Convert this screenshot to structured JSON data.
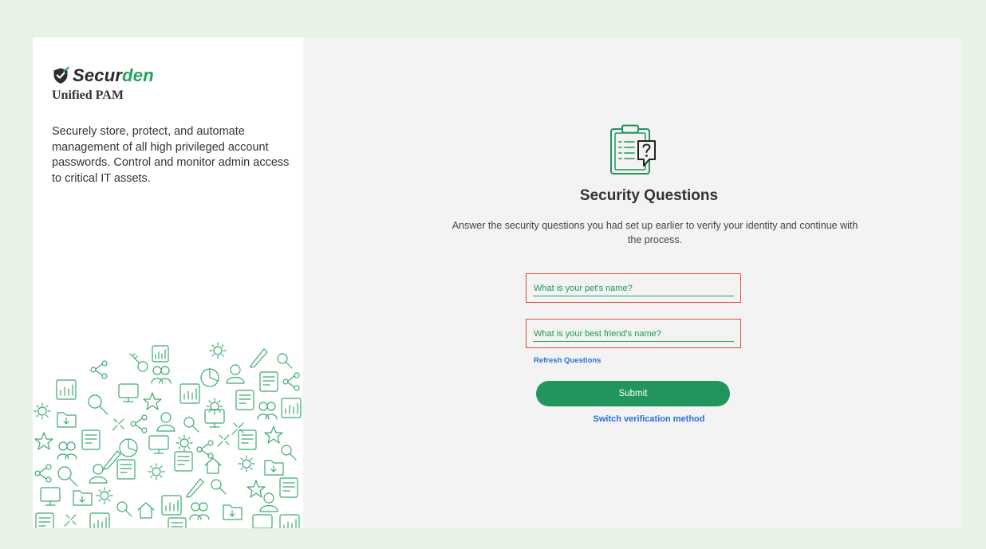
{
  "brand": {
    "logo_dark": "Secur",
    "logo_accent": "den",
    "product": "Unified PAM",
    "tagline": "Securely store, protect, and automate management of all high privileged account passwords. Control and monitor admin access to critical IT assets."
  },
  "main": {
    "title": "Security Questions",
    "description": "Answer the security questions you had set up earlier to verify your identity and continue with the process.",
    "questions": [
      {
        "placeholder": "What is your pet's name?",
        "value": ""
      },
      {
        "placeholder": "What is your best friend's name?",
        "value": ""
      }
    ],
    "refresh_label": "Refresh Questions",
    "submit_label": "Submit",
    "switch_label": "Switch verification method"
  },
  "colors": {
    "accent": "#21955b",
    "link": "#2b6fd6",
    "highlight": "#e04a3a",
    "background": "#e8f3e6"
  },
  "icons": [
    "shield-check-icon",
    "clipboard-question-icon",
    "illustration-pattern"
  ]
}
